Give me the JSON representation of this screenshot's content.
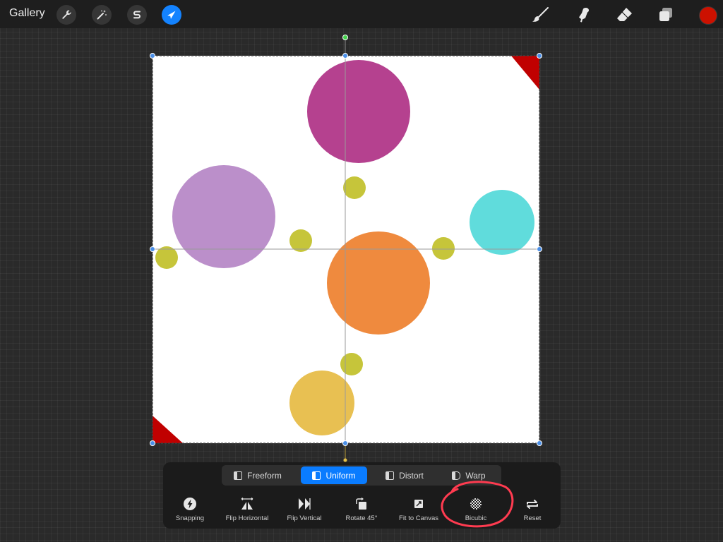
{
  "topbar": {
    "gallery_label": "Gallery",
    "left_tools": [
      {
        "icon": "wrench-icon",
        "name": "actions"
      },
      {
        "icon": "magic-wand-icon",
        "name": "adjustments"
      },
      {
        "icon": "selection-s-icon",
        "name": "selection"
      },
      {
        "icon": "arrow-cursor-icon",
        "name": "transform",
        "active": true
      }
    ],
    "right_tools": [
      "brush-icon",
      "smudge-icon",
      "eraser-icon",
      "layers-icon"
    ],
    "current_color": "#cc1100"
  },
  "colors": {
    "accent": "#0a7cff",
    "canvas_background": "#ffffff",
    "magenta": "#b5418f",
    "lavender": "#bb8fca",
    "cyan": "#60dcdc",
    "orange": "#ef8a3e",
    "yellow": "#e8c052",
    "olive": "#c6c53a",
    "corner_red": "#c00000"
  },
  "toolbar": {
    "modes": [
      {
        "label": "Freeform",
        "icon": "freeform-icon",
        "active": false
      },
      {
        "label": "Uniform",
        "icon": "uniform-icon",
        "active": true
      },
      {
        "label": "Distort",
        "icon": "distort-icon",
        "active": false
      },
      {
        "label": "Warp",
        "icon": "warp-icon",
        "active": false
      }
    ],
    "buttons": [
      {
        "label": "Snapping",
        "icon": "lightning-icon"
      },
      {
        "label": "Flip Horizontal",
        "icon": "flip-horizontal-icon"
      },
      {
        "label": "Flip Vertical",
        "icon": "flip-vertical-icon"
      },
      {
        "label": "Rotate 45°",
        "icon": "rotate-icon"
      },
      {
        "label": "Fit to Canvas",
        "icon": "fit-canvas-icon"
      },
      {
        "label": "Bicubic",
        "icon": "checker-circle-icon"
      },
      {
        "label": "Reset",
        "icon": "reset-arrows-icon"
      }
    ]
  }
}
